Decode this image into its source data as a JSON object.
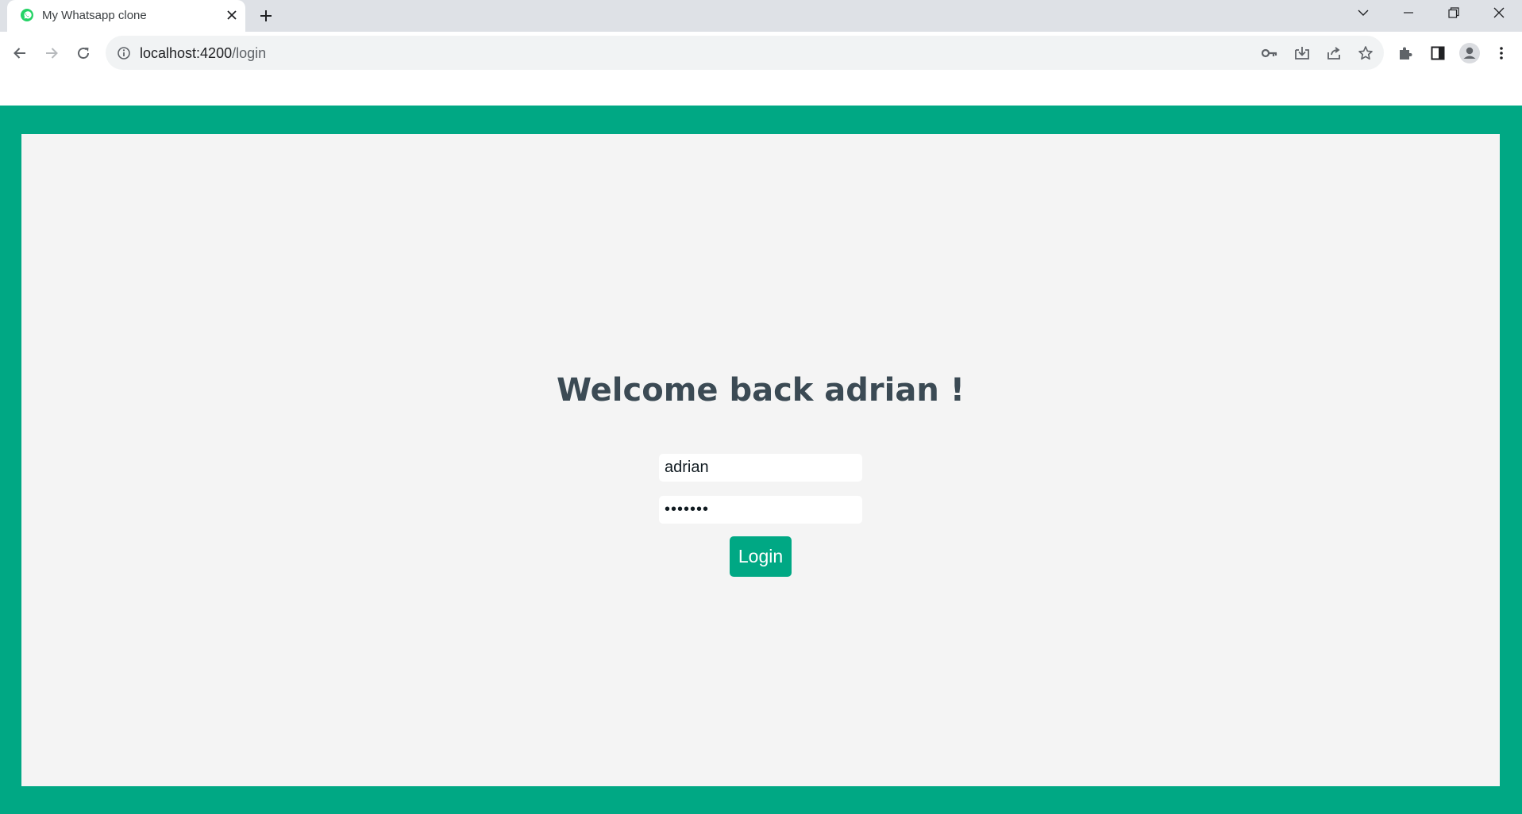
{
  "browser": {
    "tab": {
      "title": "My Whatsapp clone",
      "favicon": "whatsapp-icon"
    },
    "address": {
      "host": "localhost:4200",
      "path": "/login"
    }
  },
  "login": {
    "heading": "Welcome back adrian !",
    "username_value": "adrian",
    "password_value": "1234567",
    "button_label": "Login"
  },
  "colors": {
    "brand": "#00a884",
    "panel_bg": "#f4f4f4",
    "heading_text": "#3b4a54"
  }
}
